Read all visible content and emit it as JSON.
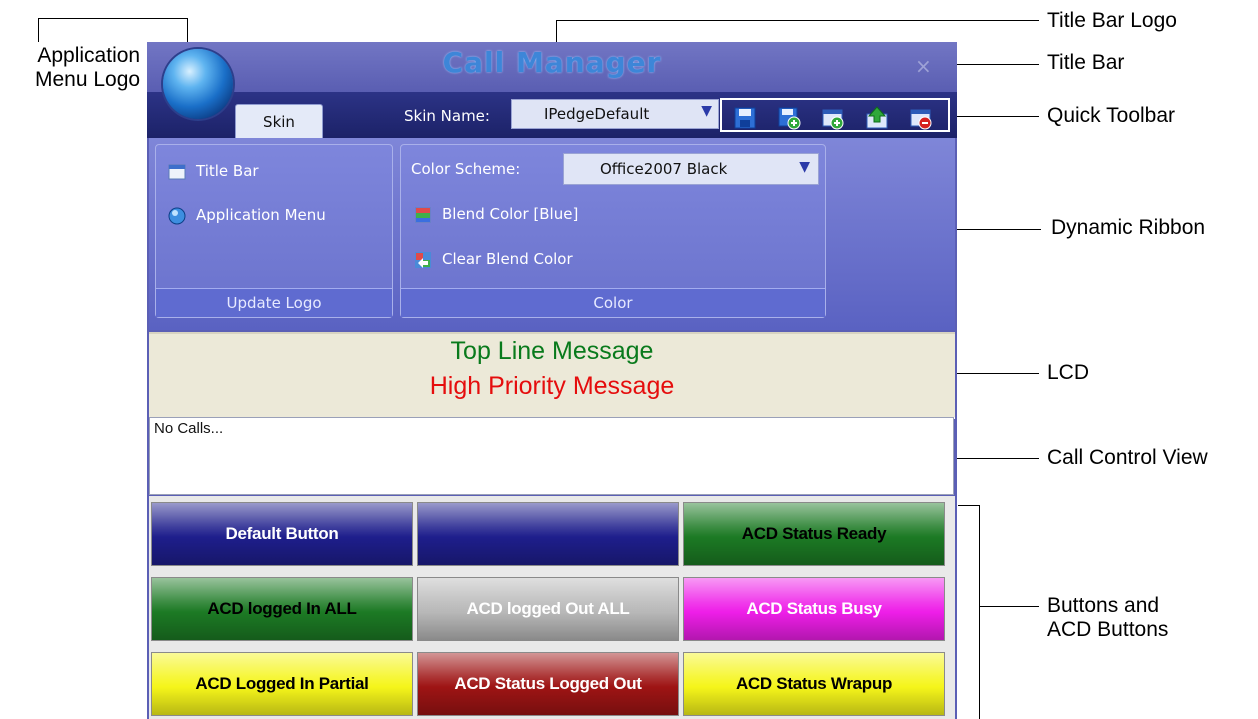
{
  "callouts": {
    "app_menu_logo": [
      "Application",
      "Menu Logo"
    ],
    "title_bar_logo": "Title Bar Logo",
    "title_bar": "Title Bar",
    "quick_toolbar": "Quick Toolbar",
    "dynamic_ribbon": "Dynamic Ribbon",
    "lcd": "LCD",
    "call_control_view": "Call Control View",
    "buttons": [
      "Buttons and",
      "ACD Buttons"
    ]
  },
  "window": {
    "title": "Call Manager",
    "close_glyph": "×",
    "tab": "Skin",
    "skin_name_label": "Skin Name:",
    "skin_name_value": "IPedgeDefault",
    "quick_toolbar_icons": [
      "save-icon",
      "save-as-new-icon",
      "new-skin-icon",
      "upload-icon",
      "delete-skin-icon"
    ]
  },
  "ribbon": {
    "update_logo": {
      "title": "Update Logo",
      "items": [
        "Title Bar",
        "Application Menu"
      ]
    },
    "color": {
      "title": "Color",
      "scheme_label": "Color Scheme:",
      "scheme_value": "Office2007 Black",
      "blend_color": "Blend Color [Blue]",
      "clear_blend": "Clear Blend Color"
    }
  },
  "lcd": {
    "top_line": "Top Line Message",
    "high_priority": "High Priority Message",
    "top_color": "#097a1c",
    "priority_color": "#e50d0d"
  },
  "call_control": {
    "text": "No Calls..."
  },
  "buttons": [
    {
      "label": "Default Button",
      "bg": "#1e1e8c",
      "fg": "#ffffff"
    },
    {
      "label": "",
      "bg": "#1e1e8c",
      "fg": "#ffffff"
    },
    {
      "label": "ACD Status Ready",
      "bg": "#1c7a24",
      "fg": "#000000"
    },
    {
      "label": "ACD logged In ALL",
      "bg": "#1c7a24",
      "fg": "#000000"
    },
    {
      "label": "ACD logged Out ALL",
      "bg": "#b8b8b8",
      "fg": "#ffffff"
    },
    {
      "label": "ACD Status Busy",
      "bg": "#ee1ee8",
      "fg": "#ffffff"
    },
    {
      "label": "ACD Logged In Partial",
      "bg": "#f5f51a",
      "fg": "#000000"
    },
    {
      "label": "ACD Status Logged Out",
      "bg": "#9e1414",
      "fg": "#ffffff"
    },
    {
      "label": "ACD Status Wrapup",
      "bg": "#f5f51a",
      "fg": "#000000"
    }
  ]
}
